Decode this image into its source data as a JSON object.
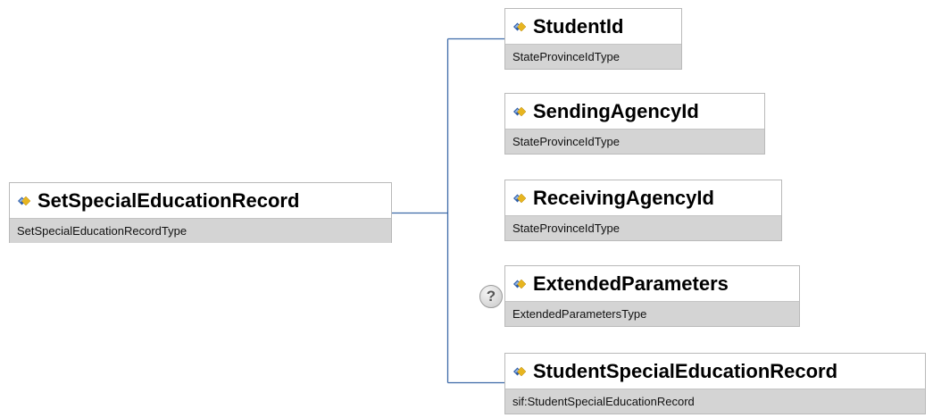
{
  "diagram": {
    "root": {
      "name": "SetSpecialEducationRecord",
      "type": "SetSpecialEducationRecordType",
      "icon": "element-diamond-icon"
    },
    "children": [
      {
        "name": "StudentId",
        "type": "StateProvinceIdType",
        "icon": "element-diamond-icon",
        "optional": false
      },
      {
        "name": "SendingAgencyId",
        "type": "StateProvinceIdType",
        "icon": "element-diamond-icon",
        "optional": false
      },
      {
        "name": "ReceivingAgencyId",
        "type": "StateProvinceIdType",
        "icon": "element-diamond-icon",
        "optional": false
      },
      {
        "name": "ExtendedParameters",
        "type": "ExtendedParametersType",
        "icon": "element-diamond-icon",
        "optional": true,
        "optional_marker": "?"
      },
      {
        "name": "StudentSpecialEducationRecord",
        "type": "sif:StudentSpecialEducationRecord",
        "icon": "element-diamond-icon",
        "optional": false
      }
    ],
    "colors": {
      "connector": "#3d6aa8",
      "type_band": "#d4d4d4",
      "border": "#b9b9b9",
      "icon_blue": "#2f5ea8",
      "icon_gold": "#e7b520"
    }
  }
}
